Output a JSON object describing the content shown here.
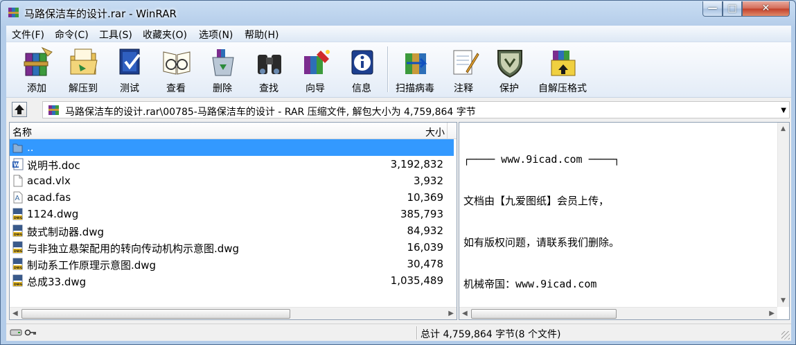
{
  "window": {
    "title": "马路保洁车的设计.rar - WinRAR",
    "minimize_glyph": "—",
    "maximize_glyph": "□",
    "close_glyph": "✕"
  },
  "menu": [
    {
      "label": "文件(F)"
    },
    {
      "label": "命令(C)"
    },
    {
      "label": "工具(S)"
    },
    {
      "label": "收藏夹(O)"
    },
    {
      "label": "选项(N)"
    },
    {
      "label": "帮助(H)"
    }
  ],
  "toolbar": [
    {
      "label": "添加",
      "icon": "add-books-icon"
    },
    {
      "label": "解压到",
      "icon": "extract-folder-icon"
    },
    {
      "label": "测试",
      "icon": "test-book-icon"
    },
    {
      "label": "查看",
      "icon": "view-glasses-icon"
    },
    {
      "label": "删除",
      "icon": "delete-recycle-icon"
    },
    {
      "label": "查找",
      "icon": "find-binoculars-icon"
    },
    {
      "label": "向导",
      "icon": "wizard-icon"
    },
    {
      "label": "信息",
      "icon": "info-icon"
    },
    {
      "label": "扫描病毒",
      "icon": "virus-scan-icon"
    },
    {
      "label": "注释",
      "icon": "comment-notepad-icon"
    },
    {
      "label": "保护",
      "icon": "protect-shield-icon"
    },
    {
      "label": "自解压格式",
      "icon": "sfx-icon"
    }
  ],
  "address": {
    "path": "马路保洁车的设计.rar\\00785-马路保洁车的设计 - RAR 压缩文件, 解包大小为 4,759,864 字节"
  },
  "file_list": {
    "columns": {
      "name": "名称",
      "size": "大小"
    },
    "rows": [
      {
        "name": "..",
        "size": "",
        "icon": "parent-folder-icon",
        "selected": true
      },
      {
        "name": "说明书.doc",
        "size": "3,192,832",
        "icon": "word-doc-icon"
      },
      {
        "name": "acad.vlx",
        "size": "3,932",
        "icon": "blank-file-icon"
      },
      {
        "name": "acad.fas",
        "size": "10,369",
        "icon": "fas-file-icon"
      },
      {
        "name": "1124.dwg",
        "size": "385,793",
        "icon": "dwg-file-icon"
      },
      {
        "name": "鼓式制动器.dwg",
        "size": "84,932",
        "icon": "dwg-file-icon"
      },
      {
        "name": "与非独立悬架配用的转向传动机构示意图.dwg",
        "size": "16,039",
        "icon": "dwg-file-icon"
      },
      {
        "name": "制动系工作原理示意图.dwg",
        "size": "30,478",
        "icon": "dwg-file-icon"
      },
      {
        "name": "总成33.dwg",
        "size": "1,035,489",
        "icon": "dwg-file-icon"
      }
    ]
  },
  "comment": {
    "lines": [
      "┌──── www.9icad.com ────┐",
      "文档由【九爱图纸】会员上传，",
      "如有版权问题，请联系我们删除。",
      "机械帝国：www.9icad.com",
      "└─────────────────┘"
    ]
  },
  "status": {
    "summary": "总计 4,759,864 字节(8 个文件)"
  },
  "colors": {
    "selection": "#3399ff",
    "frame": "#b9d1ea",
    "close_button": "#c2402a"
  }
}
